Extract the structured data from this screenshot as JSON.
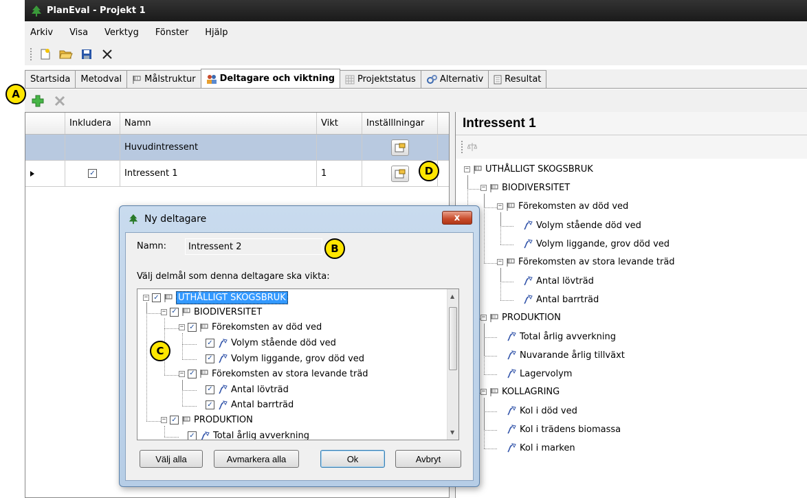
{
  "window": {
    "title": "PlanEval - Projekt 1"
  },
  "menu": [
    "Arkiv",
    "Visa",
    "Verktyg",
    "Fönster",
    "Hjälp"
  ],
  "tabs": [
    "Startsida",
    "Metodval",
    "Målstruktur",
    "Deltagare och viktning",
    "Projektstatus",
    "Alternativ",
    "Resultat"
  ],
  "grid": {
    "headers": [
      "Inkludera",
      "Namn",
      "Vikt",
      "Inställlningar"
    ],
    "rows": [
      {
        "name": "Huvudintressent",
        "weight": ""
      },
      {
        "name": "Intressent 1",
        "weight": "1"
      }
    ]
  },
  "right_panel": {
    "title": "Intressent 1",
    "tree": [
      "UTHÅLLIGT SKOGSBRUK",
      "BIODIVERSITET",
      "Förekomsten av död ved",
      "Volym stående död ved",
      "Volym liggande, grov död ved",
      "Förekomsten av stora levande träd",
      "Antal lövträd",
      "Antal barrträd",
      "PRODUKTION",
      "Total årlig avverkning",
      "Nuvarande årlig tillväxt",
      "Lagervolym",
      "KOLLAGRING",
      "Kol i död ved",
      "Kol i trädens biomassa",
      "Kol i marken"
    ]
  },
  "dialog": {
    "title": "Ny deltagare",
    "close": "x",
    "name_label": "Namn:",
    "name_value": "Intressent 2",
    "instruction": "Välj delmål som denna deltagare ska vikta:",
    "tree": [
      "UTHÅLLIGT SKOGSBRUK",
      "BIODIVERSITET",
      "Förekomsten av död ved",
      "Volym stående död ved",
      "Volym liggande, grov död ved",
      "Förekomsten av stora levande träd",
      "Antal lövträd",
      "Antal barrträd",
      "PRODUKTION",
      "Total årlig avverkning"
    ],
    "buttons": {
      "select_all": "Välj alla",
      "deselect_all": "Avmarkera alla",
      "ok": "Ok",
      "cancel": "Avbryt"
    }
  },
  "callouts": [
    "A",
    "B",
    "C",
    "D"
  ],
  "colors": {
    "accent": "#3399ff",
    "selected_row": "#b8c9e0",
    "callout": "#ffe600"
  }
}
